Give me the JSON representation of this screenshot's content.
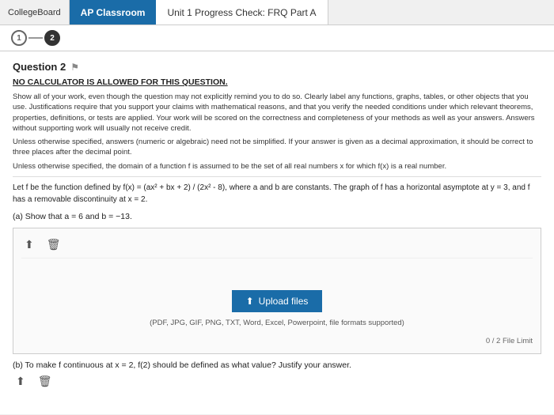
{
  "topbar": {
    "college_board_label": "CollegeBoard",
    "tab_ap_label": "AP Classroom",
    "tab_unit_label": "Unit 1 Progress Check: FRQ Part A"
  },
  "steps": {
    "step1_label": "1",
    "step2_label": "2"
  },
  "question": {
    "title": "Question 2",
    "no_calc": "NO CALCULATOR IS ALLOWED FOR THIS QUESTION.",
    "instruction1": "Show all of your work, even though the question may not explicitly remind you to do so. Clearly label any functions, graphs, tables, or other objects that you use. Justifications require that you support your claims with mathematical reasons, and that you verify the needed conditions under which relevant theorems, properties, definitions, or tests are applied. Your work will be scored on the correctness and completeness of your methods as well as your answers. Answers without supporting work will usually not receive credit.",
    "instruction2": "Unless otherwise specified, answers (numeric or algebraic) need not be simplified. If your answer is given as a decimal approximation, it should be correct to three places after the decimal point.",
    "instruction3": "Unless otherwise specified, the domain of a function f is assumed to be the set of all real numbers x for which f(x) is a real number.",
    "problem": "Let f be the function defined by f(x) = (ax² + bx + 2) / (2x² - 8), where a and b are constants. The graph of f has a horizontal asymptote at y = 3, and f has a removable discontinuity at x = 2.",
    "part_a_label": "(a) Show that a = 6 and b = −13.",
    "upload_hint": "(PDF, JPG, GIF, PNG, TXT, Word, Excel, Powerpoint, file formats supported)",
    "file_limit": "0 / 2 File Limit",
    "upload_button_label": "Upload files",
    "part_b_label": "(b) To make f continuous at x = 2, f(2) should be defined as what value? Justify your answer."
  },
  "icons": {
    "upload_arrow": "⬆",
    "flag": "⚑",
    "trash": "🗑",
    "upload_icon": "↑"
  }
}
